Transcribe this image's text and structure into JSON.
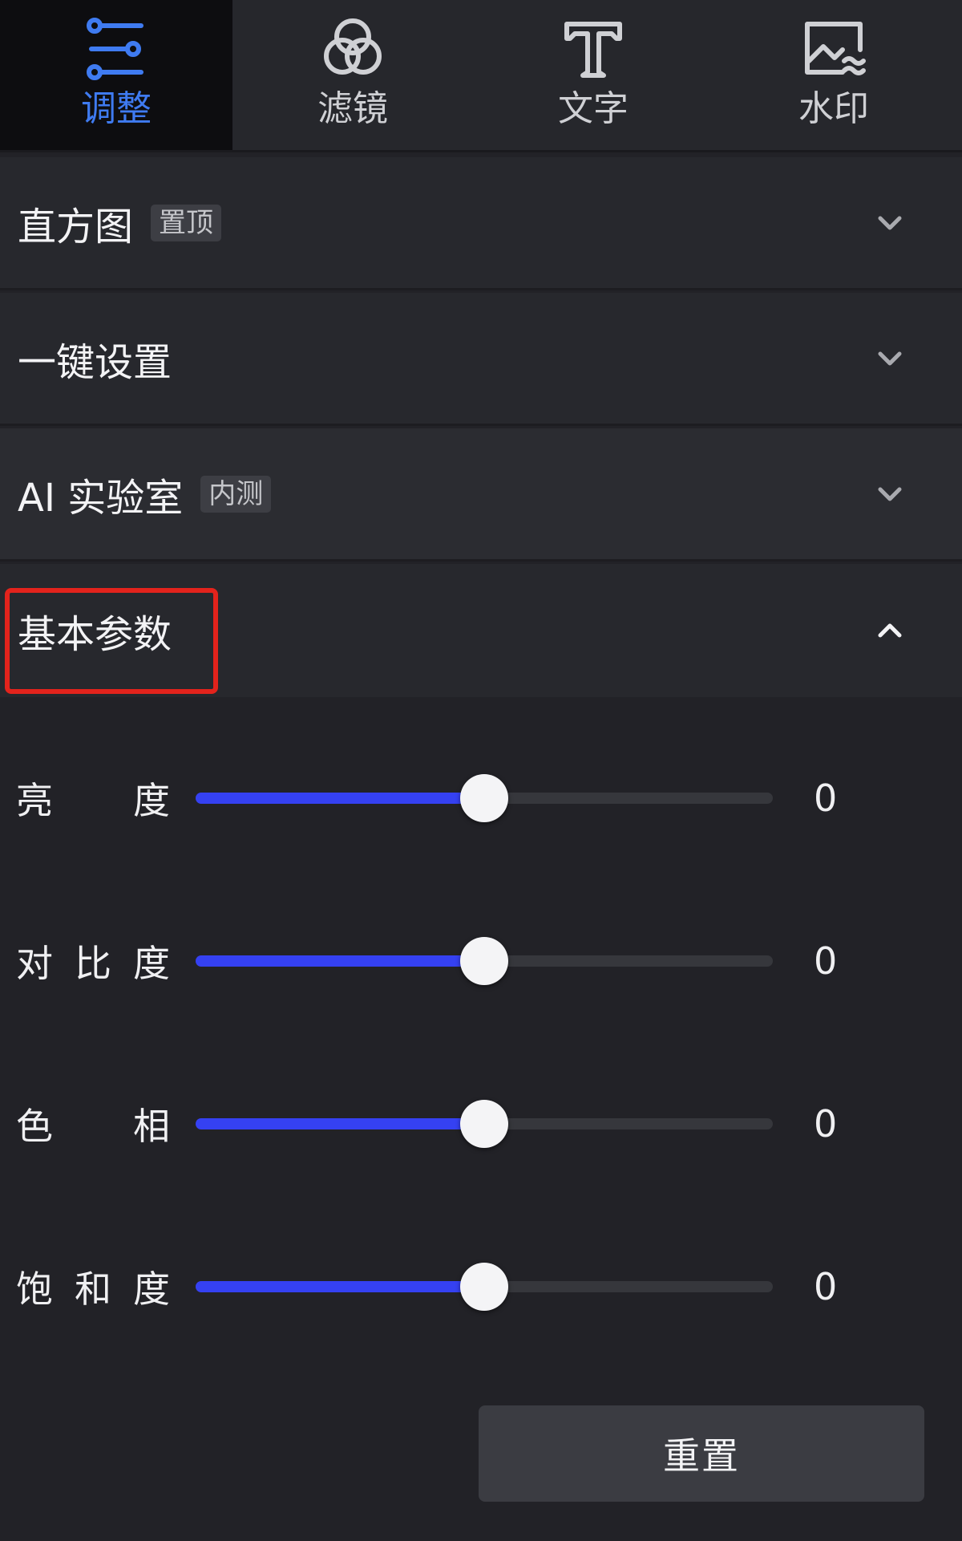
{
  "tabs": [
    {
      "label": "调整",
      "icon": "sliders-icon",
      "active": true
    },
    {
      "label": "滤镜",
      "icon": "filter-circles-icon",
      "active": false
    },
    {
      "label": "文字",
      "icon": "text-icon",
      "active": false
    },
    {
      "label": "水印",
      "icon": "watermark-image-icon",
      "active": false
    }
  ],
  "sections": {
    "histogram": {
      "title": "直方图",
      "tag": "置顶",
      "icon": "chevron-down-icon"
    },
    "one_click": {
      "title": "一键设置",
      "icon": "chevron-down-icon"
    },
    "ai_lab": {
      "title": "AI 实验室",
      "tag": "内测",
      "icon": "chevron-down-icon"
    },
    "basic": {
      "title": "基本参数",
      "icon": "chevron-up-icon"
    }
  },
  "sliders": [
    {
      "label_chars": [
        "亮",
        "度"
      ],
      "value": "0",
      "level": 0.5
    },
    {
      "label_chars": [
        "对",
        "比",
        "度"
      ],
      "value": "0",
      "level": 0.5
    },
    {
      "label_chars": [
        "色",
        "相"
      ],
      "value": "0",
      "level": 0.5
    },
    {
      "label_chars": [
        "饱",
        "和",
        "度"
      ],
      "value": "0",
      "level": 0.5
    }
  ],
  "reset_label": "重置",
  "colors": {
    "accent": "#3f7bf1",
    "slider_fill": "#3541f2",
    "highlight": "#e3231c"
  }
}
